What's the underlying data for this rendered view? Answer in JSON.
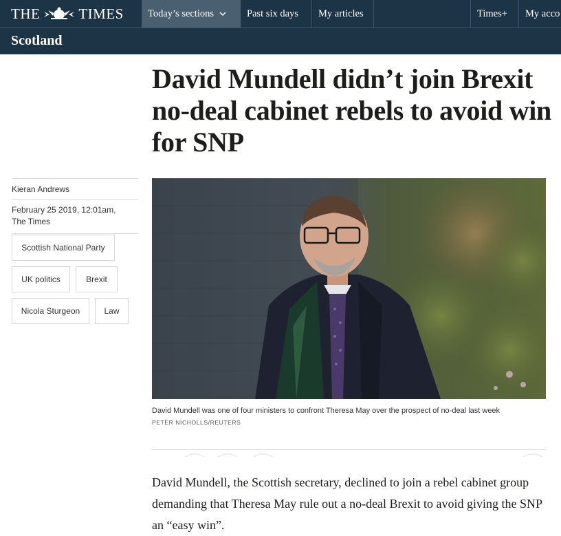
{
  "header": {
    "logo_left": "THE",
    "logo_right": "TIMES",
    "nav": {
      "today": "Today’s sections",
      "past": "Past six days",
      "articles": "My articles",
      "timesplus": "Times+",
      "account": "My acco"
    },
    "section": "Scotland"
  },
  "article": {
    "headline": "David Mundell didn’t join Brexit no-deal cabinet rebels to avoid win for SNP",
    "author": "Kieran Andrews",
    "date": "February 25 2019, 12:01am,",
    "publication": "The Times",
    "tags": [
      "Scottish National Party",
      "UK politics",
      "Brexit",
      "Nicola Sturgeon",
      "Law"
    ],
    "caption": "David Mundell was one of four ministers to confront Theresa May over the prospect of no-deal last week",
    "credit": "PETER NICHOLLS/REUTERS",
    "body": "David Mundell, the Scottish secretary, declined to join a rebel cabinet group demanding that Theresa May rule out a no-deal Brexit to avoid giving the SNP an “easy win”."
  },
  "colors": {
    "nav_background": "#1d3346",
    "nav_active": "#4a6070"
  }
}
